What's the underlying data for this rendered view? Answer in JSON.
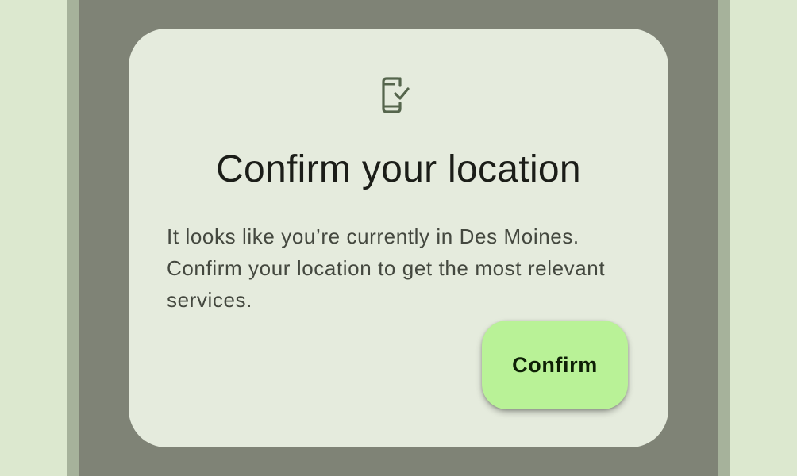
{
  "colors": {
    "background": "#dce8cf",
    "scrim": "#7f8376",
    "dialog_surface": "#e5ebdd",
    "icon": "#55654c",
    "title": "#1b1d18",
    "body_text": "#44483f",
    "button": "#b9f297",
    "button_text": "#0e2006"
  },
  "dialog": {
    "icon": "mobile-check-icon",
    "title": "Confirm your location",
    "body": "It looks like you’re currently in Des Moines. Confirm your location to get the most relevant services.",
    "confirm_label": "Confirm"
  }
}
